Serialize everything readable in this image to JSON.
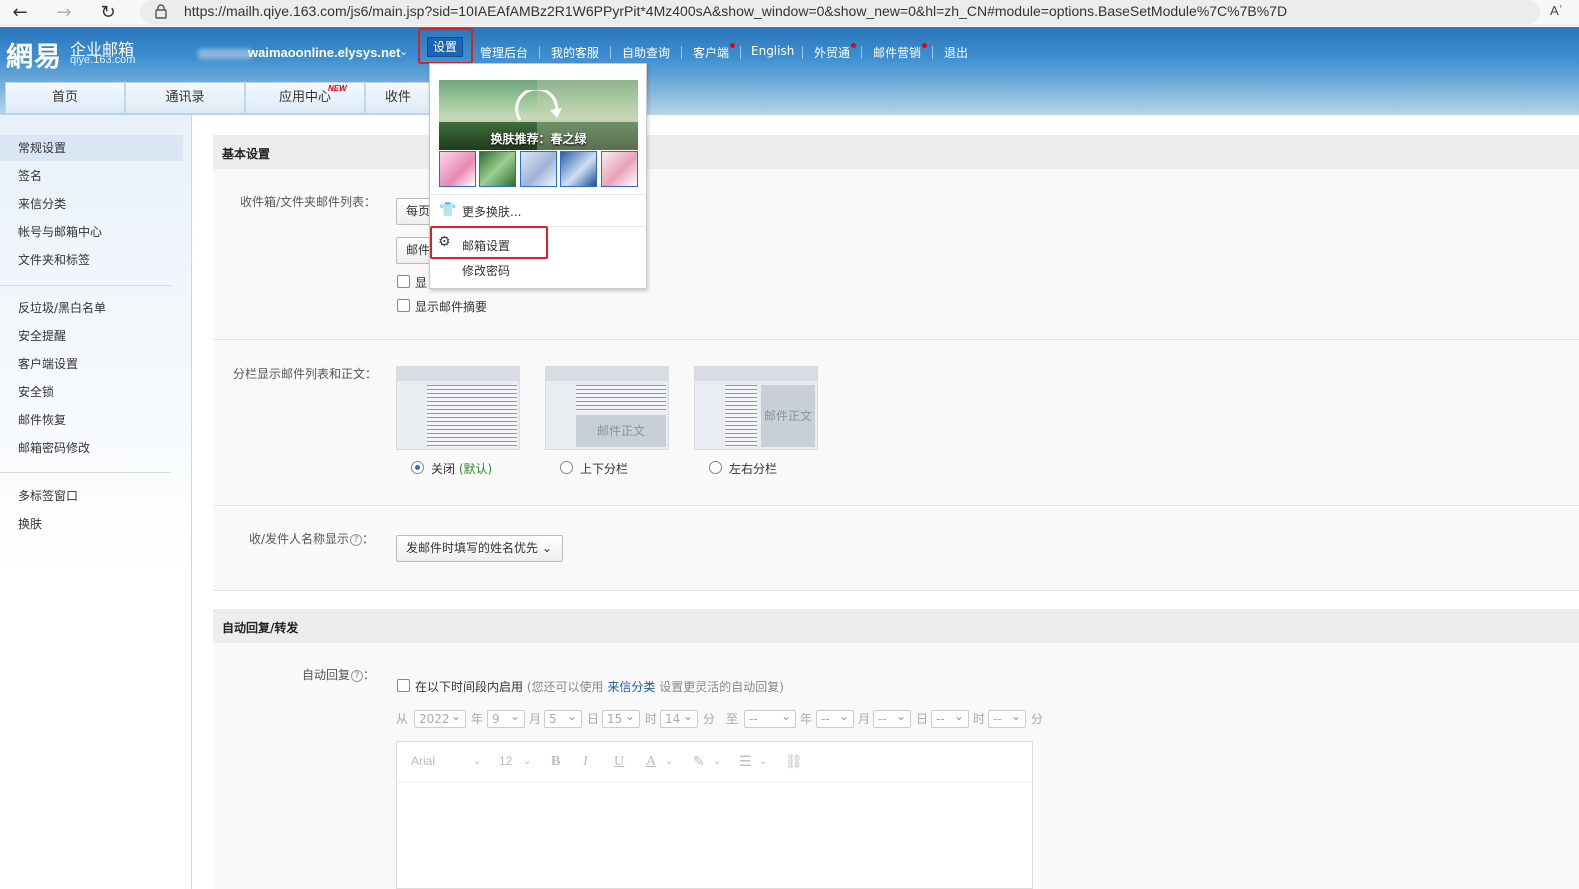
{
  "browser": {
    "url": "https://mailh.qiye.163.com/js6/main.jsp?sid=10IAEAfAMBz2R1W6PPyrPit*4Mz400sA&show_window=0&show_new=0&hl=zh_CN#module=options.BaseSetModule%7C%7B%7D",
    "reader_label": "Aʾ"
  },
  "header": {
    "logo_main": "網易",
    "logo_sub": "企业邮箱",
    "logo_domain": "qiye.163.com",
    "account": "waimaoonline.elysys.net",
    "nav": [
      "设置",
      "管理后台",
      "我的客服",
      "自助查询",
      "客户端",
      "English",
      "外贸通",
      "邮件营销",
      "退出"
    ],
    "main_tabs": [
      "首页",
      "通讯录",
      "应用中心",
      "收件"
    ],
    "new_badge": "NEW"
  },
  "sidebar": {
    "group1": [
      "常规设置",
      "签名",
      "来信分类",
      "帐号与邮箱中心",
      "文件夹和标签"
    ],
    "group2": [
      "反垃圾/黑白名单",
      "安全提醒",
      "客户端设置",
      "安全锁",
      "邮件恢复",
      "邮箱密码修改"
    ],
    "group3": [
      "多标签窗口",
      "换肤"
    ]
  },
  "main": {
    "basic_title": "基本设置",
    "list_label": "收件箱/文件夹邮件列表：",
    "sel1_partial": "每页",
    "sel2_partial": "邮件",
    "cb1_partial": "显",
    "cb2_label": "显示邮件摘要",
    "split_label": "分栏显示邮件列表和正文：",
    "thumb_body_text": "邮件正文",
    "radio_off": "关闭",
    "radio_default": "(默认)",
    "radio_tb": "上下分栏",
    "radio_lr": "左右分栏",
    "name_label": "收/发件人名称显示",
    "name_select": "发邮件时填写的姓名优先",
    "auto_title": "自动回复/转发",
    "auto_label": "自动回复",
    "auto_cb": "在以下时间段内启用",
    "auto_hint_a": "(您还可以使用",
    "auto_hint_link": "来信分类",
    "auto_hint_b": "设置更灵活的自动回复)",
    "help_glyph": "?",
    "date": {
      "from": "从",
      "to": "至",
      "y": "年",
      "m": "月",
      "d": "日",
      "h": "时",
      "min": "分",
      "start": [
        "2022",
        "9",
        "5",
        "15",
        "14"
      ],
      "end": [
        "--",
        "--",
        "--",
        "--",
        "--"
      ]
    },
    "editor": {
      "font": "Arial",
      "size": "12",
      "bold": "B",
      "italic": "I",
      "underline": "U",
      "color": "A"
    }
  },
  "dropdown": {
    "skin_caption": "换肤推荐：春之绿",
    "more_skins": "更多换肤...",
    "mail_settings": "邮箱设置",
    "change_password": "修改密码"
  },
  "colors": {
    "header_blue": "#3d8fd1",
    "highlight_red": "#e02020",
    "settings_btn": "#1d64b4"
  }
}
